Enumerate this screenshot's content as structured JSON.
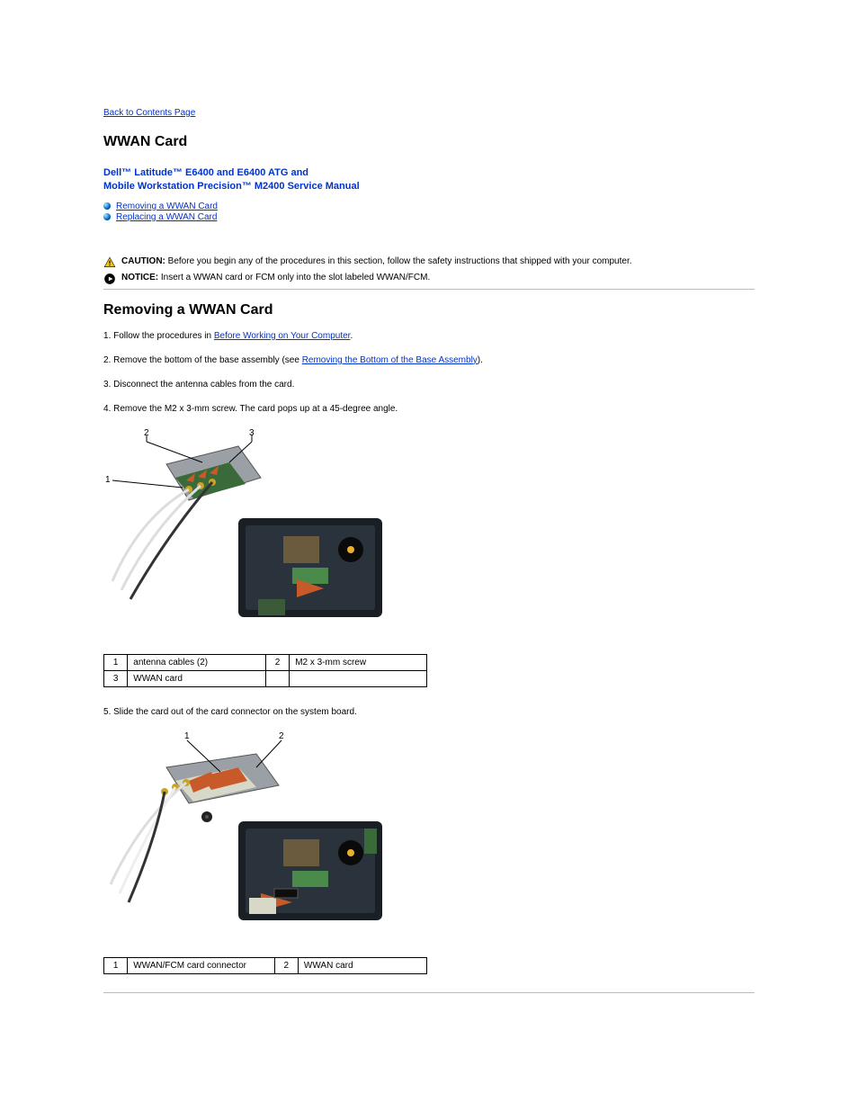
{
  "nav": {
    "back_link": "Back to Contents Page"
  },
  "doc_title": {
    "heading": "WWAN Card",
    "line1": "Dell™ Latitude™ E6400 and E6400 ATG and",
    "line2": "Mobile Workstation Precision™ M2400 Service Manual"
  },
  "toc": {
    "item1": "Removing a WWAN Card",
    "item2": "Replacing a WWAN Card"
  },
  "caution": {
    "label": "CAUTION:",
    "text": "Before you begin any of the procedures in this section, follow the safety instructions that shipped with your computer."
  },
  "notice": {
    "label": "NOTICE:",
    "text": "Insert a WWAN card or FCM only into the slot labeled WWAN/FCM."
  },
  "section1": {
    "title": "Removing a WWAN Card",
    "steps": {
      "s1a": "Follow the procedures in ",
      "s1_link": "Before Working on Your Computer",
      "s1b": ".",
      "s2a": "Remove the bottom of the base assembly (see ",
      "s2_link": "Removing the Bottom of the Base Assembly",
      "s2b": ").",
      "s3": "Disconnect the antenna cables from the card.",
      "s4": "Remove the M2 x 3-mm screw. The card pops up at a 45-degree angle.",
      "s5": "Slide the card out of the card connector on the system board."
    },
    "table1": {
      "r1c1n": "1",
      "r1c1": "antenna cables (2)",
      "r1c2n": "2",
      "r1c2": "M2 x 3-mm screw",
      "r2c1n": "3",
      "r2c1": "WWAN card",
      "r2c2n": "",
      "r2c2": ""
    },
    "table2": {
      "r1c1n": "1",
      "r1c1": "WWAN/FCM card connector",
      "r1c2n": "2",
      "r1c2": "WWAN card"
    }
  }
}
